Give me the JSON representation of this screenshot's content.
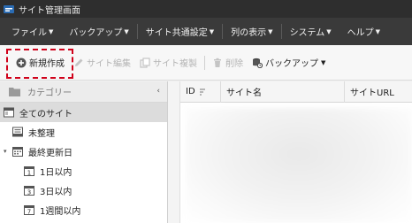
{
  "window": {
    "title": "サイト管理画面"
  },
  "menu": [
    {
      "label": "ファイル",
      "name": "menu-file"
    },
    {
      "label": "バックアップ",
      "name": "menu-backup"
    },
    {
      "label": "サイト共通設定",
      "name": "menu-site-settings"
    },
    {
      "label": "列の表示",
      "name": "menu-columns"
    },
    {
      "label": "システム",
      "name": "menu-system"
    },
    {
      "label": "ヘルプ",
      "name": "menu-help"
    }
  ],
  "toolbar": {
    "new_label": "新規作成",
    "edit_label": "サイト編集",
    "copy_label": "サイト複製",
    "delete_label": "削除",
    "backup_label": "バックアップ"
  },
  "sidebar": {
    "header": "カテゴリー",
    "items": [
      {
        "label": "全てのサイト",
        "selected": true
      },
      {
        "label": "未整理"
      },
      {
        "label": "最終更新日",
        "expanded": true
      },
      {
        "label": "1日以内",
        "icon_digit": "1"
      },
      {
        "label": "3日以内",
        "icon_digit": "3"
      },
      {
        "label": "1週間以内",
        "icon_digit": "7"
      }
    ]
  },
  "table": {
    "columns": [
      "ID",
      "サイト名",
      "サイトURL"
    ]
  },
  "colors": {
    "titlebar": "#2e2e2e",
    "menubar": "#3a3a3a",
    "highlight": "#d0021b",
    "new_icon": "#555555"
  }
}
